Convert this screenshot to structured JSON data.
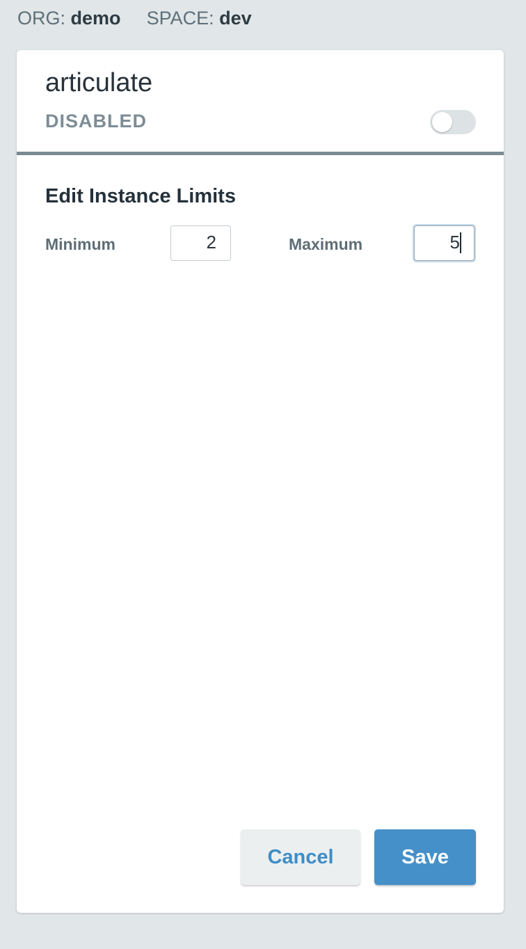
{
  "context": {
    "org_label": "ORG:",
    "org_value": "demo",
    "space_label": "SPACE:",
    "space_value": "dev"
  },
  "app": {
    "name": "articulate",
    "status": "DISABLED",
    "enabled": false
  },
  "limits": {
    "title": "Edit Instance Limits",
    "minimum_label": "Minimum",
    "minimum_value": "2",
    "maximum_label": "Maximum",
    "maximum_value": "5"
  },
  "actions": {
    "cancel_label": "Cancel",
    "save_label": "Save"
  },
  "colors": {
    "page_background": "#e1e6e8",
    "primary_blue": "#4690c9",
    "header_divider": "#7a8a93"
  }
}
